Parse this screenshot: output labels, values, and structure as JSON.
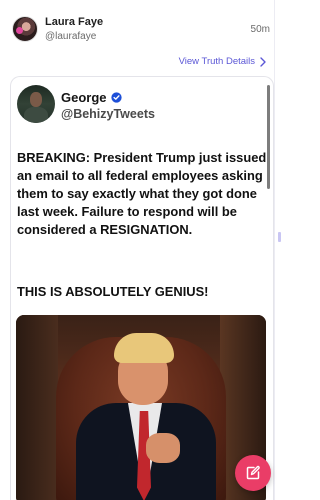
{
  "post": {
    "author_name": "Laura Faye",
    "author_handle": "@laurafaye",
    "time_ago": "50m",
    "details_link": "View Truth Details"
  },
  "embedded_tweet": {
    "author_name": "George",
    "author_handle": "@BehizyTweets",
    "paragraph_1": "BREAKING: President Trump just issued an email to all federal employees asking them to say exactly what they got done last week. Failure to respond will be considered a RESIGNATION.",
    "paragraph_2": "THIS IS ABSOLUTELY GENIUS!"
  },
  "icons": {
    "verified": "verified-badge-icon",
    "chevron": "chevron-right-icon",
    "compose": "compose-icon"
  },
  "colors": {
    "accent_link": "#5b57d6",
    "fab": "#ea3d67",
    "verified": "#1d4fd8"
  }
}
